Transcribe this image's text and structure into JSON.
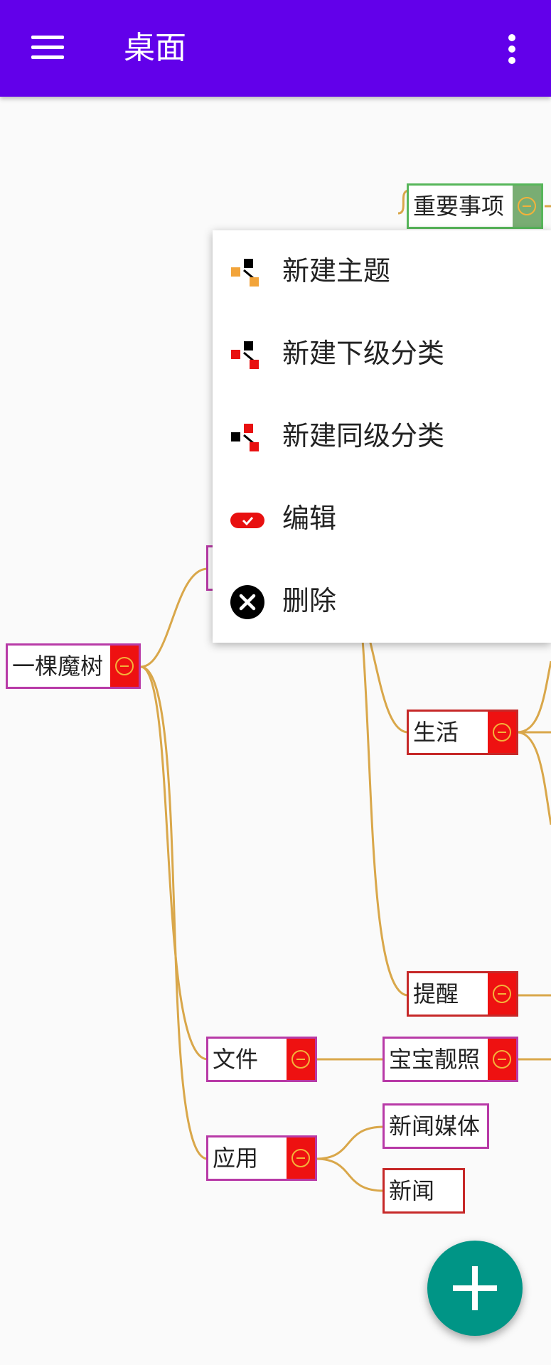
{
  "appbar": {
    "title": "桌面",
    "color": "#6200ea"
  },
  "mindmap": {
    "edge_color": "#d9a74a",
    "nodes": [
      {
        "id": "root",
        "label": "一棵魔树",
        "collapse_icon": "minus-circle-icon"
      },
      {
        "id": "important",
        "label": "重要事项",
        "collapse_icon": "minus-circle-icon"
      },
      {
        "id": "life",
        "label": "生活",
        "collapse_icon": "minus-circle-icon"
      },
      {
        "id": "reminder",
        "label": "提醒",
        "collapse_icon": "minus-circle-icon"
      },
      {
        "id": "files",
        "label": "文件",
        "collapse_icon": "minus-circle-icon"
      },
      {
        "id": "baby-photos",
        "label": "宝宝靓照",
        "collapse_icon": "minus-circle-icon"
      },
      {
        "id": "apps",
        "label": "应用",
        "collapse_icon": "minus-circle-icon"
      },
      {
        "id": "news-media",
        "label": "新闻媒体"
      },
      {
        "id": "news",
        "label": "新闻"
      }
    ]
  },
  "context_menu": {
    "items": [
      {
        "label": "新建主题",
        "icon": "new-topic-icon"
      },
      {
        "label": "新建下级分类",
        "icon": "new-child-icon"
      },
      {
        "label": "新建同级分类",
        "icon": "new-sibling-icon"
      },
      {
        "label": "编辑",
        "icon": "edit-icon"
      },
      {
        "label": "删除",
        "icon": "delete-icon"
      }
    ]
  },
  "fab": {
    "icon": "plus-icon",
    "color": "#009586"
  }
}
